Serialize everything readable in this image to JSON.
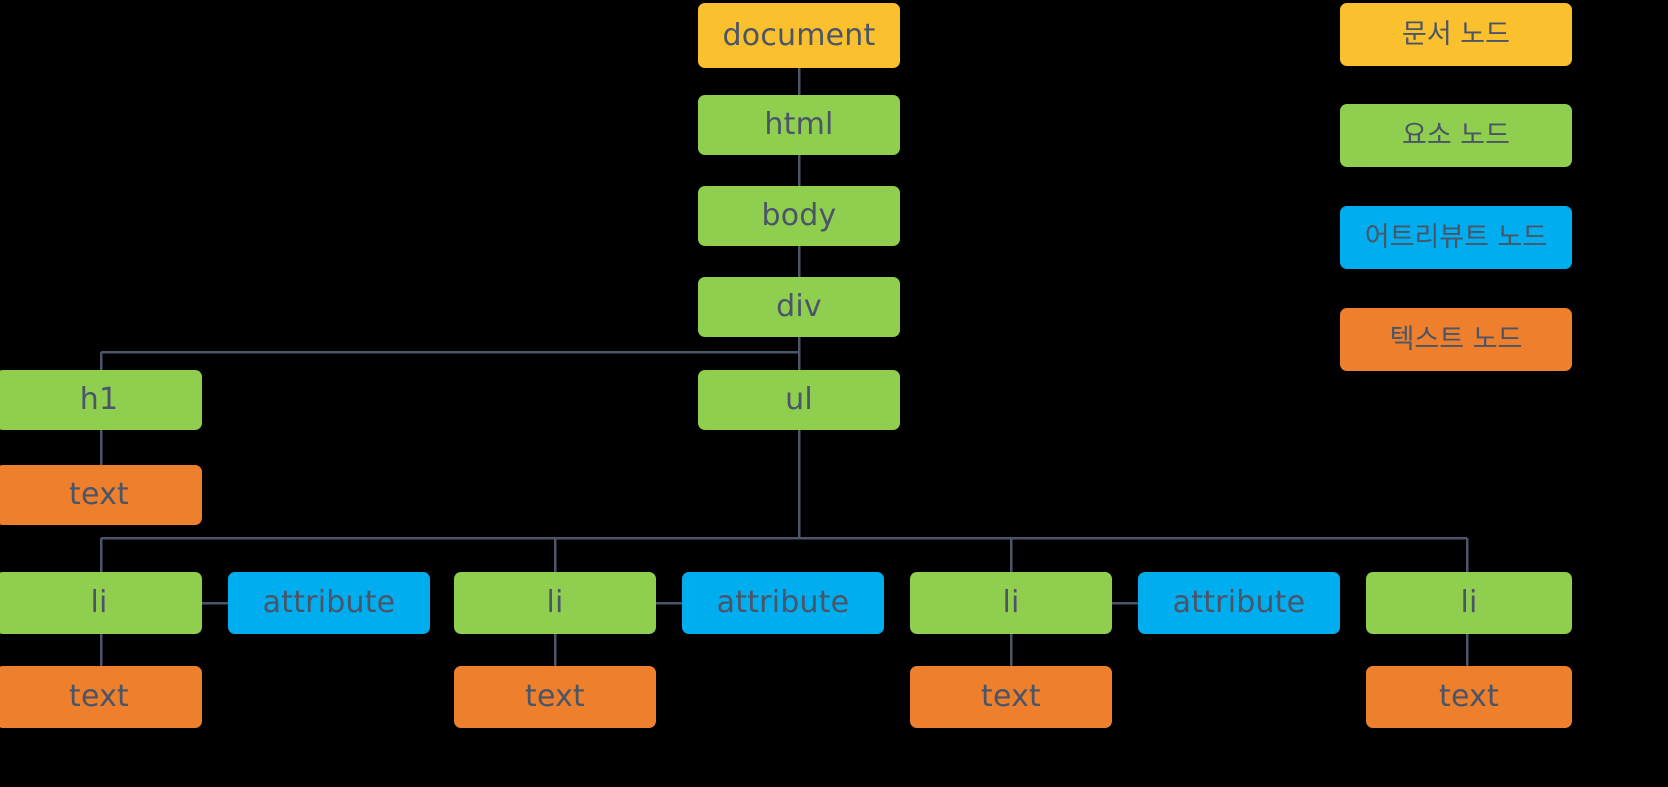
{
  "meta": {
    "background_color": "#000000",
    "node_text_color": "#4a5568",
    "edge_color": "#4a5568"
  },
  "palette": {
    "document_node": "#FBC02D",
    "element_node": "#90CE4F",
    "attribute_node": "#00AEEF",
    "text_node": "#EE7F2D"
  },
  "tree": {
    "document": {
      "label": "document",
      "type": "document_node"
    },
    "html": {
      "label": "html",
      "type": "element_node"
    },
    "body": {
      "label": "body",
      "type": "element_node"
    },
    "div": {
      "label": "div",
      "type": "element_node"
    },
    "h1": {
      "label": "h1",
      "type": "element_node"
    },
    "h1_text": {
      "label": "text",
      "type": "text_node"
    },
    "ul": {
      "label": "ul",
      "type": "element_node"
    },
    "li1": {
      "label": "li",
      "type": "element_node"
    },
    "attr1": {
      "label": "attribute",
      "type": "attribute_node"
    },
    "text1": {
      "label": "text",
      "type": "text_node"
    },
    "li2": {
      "label": "li",
      "type": "element_node"
    },
    "attr2": {
      "label": "attribute",
      "type": "attribute_node"
    },
    "text2": {
      "label": "text",
      "type": "text_node"
    },
    "li3": {
      "label": "li",
      "type": "element_node"
    },
    "attr3": {
      "label": "attribute",
      "type": "attribute_node"
    },
    "text3": {
      "label": "text",
      "type": "text_node"
    },
    "li4": {
      "label": "li",
      "type": "element_node"
    },
    "text4": {
      "label": "text",
      "type": "text_node"
    }
  },
  "legend": {
    "items": [
      {
        "label": "문서 노드",
        "type": "document_node"
      },
      {
        "label": "요소 노드",
        "type": "element_node"
      },
      {
        "label": "어트리뷰트 노드",
        "type": "attribute_node"
      },
      {
        "label": "텍스트 노드",
        "type": "text_node"
      }
    ]
  }
}
